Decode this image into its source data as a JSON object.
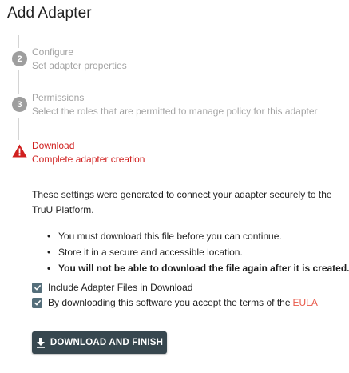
{
  "header": {
    "title": "Add Adapter"
  },
  "steps": [
    {
      "number": "2",
      "title": "Configure",
      "subtitle": "Set adapter properties",
      "state": "inactive"
    },
    {
      "number": "3",
      "title": "Permissions",
      "subtitle": "Select the roles that are permitted to manage policy for this adapter",
      "state": "inactive"
    },
    {
      "number": "",
      "title": "Download",
      "subtitle": "Complete adapter creation",
      "state": "error",
      "icon": "warning-icon"
    }
  ],
  "content": {
    "description": "These settings were generated to connect your adapter securely to the TruU Platform.",
    "bullets": [
      "You must download this file before you can continue.",
      "Store it in a secure and accessible location.",
      "You will not be able to download the file again after it is created."
    ],
    "checkboxes": [
      {
        "label": "Include Adapter Files in Download",
        "checked": true
      },
      {
        "label": "By downloading this software you accept the terms of the",
        "link": "EULA",
        "checked": true
      }
    ],
    "download_button": "DOWNLOAD AND FINISH"
  },
  "colors": {
    "error": "#d0201f",
    "inactive": "#9e9e9e",
    "checkbox": "#546e7a",
    "button": "#37474f",
    "link": "#e8594a"
  }
}
